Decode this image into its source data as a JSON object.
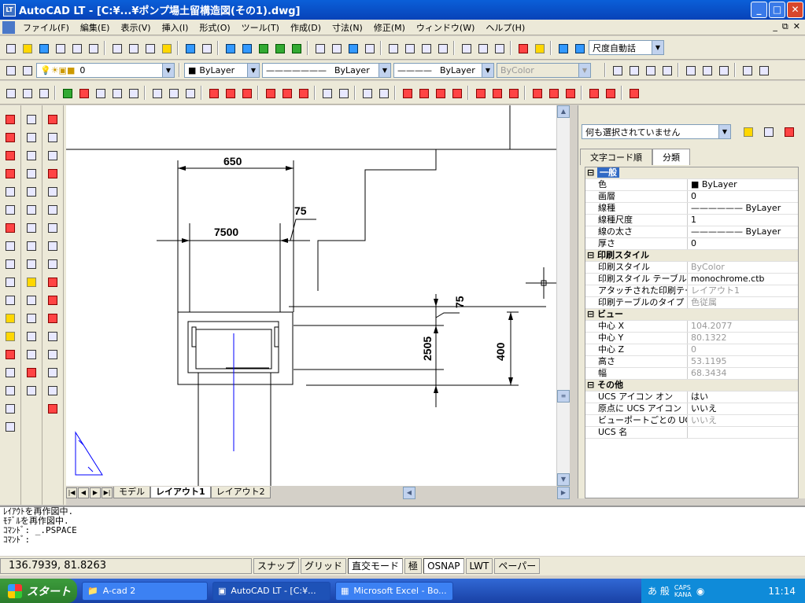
{
  "window": {
    "title": "AutoCAD LT - [C:¥...¥ポンプ場土留構造図(その1).dwg]",
    "min": "_",
    "max": "□",
    "close": "✕"
  },
  "menu": {
    "items": [
      "ファイル(F)",
      "編集(E)",
      "表示(V)",
      "挿入(I)",
      "形式(O)",
      "ツール(T)",
      "作成(D)",
      "寸法(N)",
      "修正(M)",
      "ウィンドウ(W)",
      "ヘルプ(H)"
    ],
    "mdi_min": "_",
    "mdi_restore": "⧉",
    "mdi_close": "✕"
  },
  "toolbar": {
    "dimstyle": "尺度自動話",
    "layer": "0",
    "color": "ByLayer",
    "linetype": "ByLayer",
    "lineweight": "ByLayer",
    "plotstyle": "ByColor"
  },
  "drawing": {
    "dim_650": "650",
    "dim_75_top": "75",
    "dim_7500": "7500",
    "dim_75_right": "75",
    "dim_2505": "2505",
    "dim_400": "400"
  },
  "tabs": {
    "model": "モデル",
    "layout1": "レイアウト1",
    "layout2": "レイアウト2"
  },
  "props": {
    "selection": "何も選択されていません",
    "tab_alpha": "文字コード順",
    "tab_cat": "分類",
    "general": "一般",
    "color_k": "色",
    "color_v": "■ ByLayer",
    "layer_k": "画層",
    "layer_v": "0",
    "ltype_k": "線種",
    "ltype_v": "——————  ByLayer",
    "ltscale_k": "線種尺度",
    "ltscale_v": "1",
    "lweight_k": "線の太さ",
    "lweight_v": "——————  ByLayer",
    "thick_k": "厚さ",
    "thick_v": "0",
    "plot": "印刷スタイル",
    "pstyle_k": "印刷スタイル",
    "pstyle_v": "ByColor",
    "ptable_k": "印刷スタイル テーブル",
    "ptable_v": "monochrome.ctb",
    "attach_k": "アタッチされた印刷テーブル",
    "attach_v": "レイアウト1",
    "ptype_k": "印刷テーブルのタイプ",
    "ptype_v": "色従属",
    "view": "ビュー",
    "cx_k": "中心 X",
    "cx_v": "104.2077",
    "cy_k": "中心 Y",
    "cy_v": "80.1322",
    "cz_k": "中心 Z",
    "cz_v": "0",
    "h_k": "高さ",
    "h_v": "53.1195",
    "w_k": "幅",
    "w_v": "68.3434",
    "misc": "その他",
    "ucson_k": "UCS アイコン オン",
    "ucson_v": "はい",
    "ucsorg_k": "原点に UCS アイコン",
    "ucsorg_v": "いいえ",
    "ucsvp_k": "ビューポートごとの UCS",
    "ucsvp_v": "いいえ",
    "ucsname_k": "UCS 名",
    "ucsname_v": ""
  },
  "command": {
    "line1": "ﾚｲｱｳﾄを再作図中.",
    "line2": "ﾓﾃﾞﾙを再作図中.",
    "line3": "ｺﾏﾝﾄﾞ: _.PSPACE",
    "line4": "ｺﾏﾝﾄﾞ:"
  },
  "status": {
    "coords": "136.7939, 81.8263",
    "snap": "スナップ",
    "grid": "グリッド",
    "ortho": "直交モード",
    "polar": "極",
    "osnap": "OSNAP",
    "lwt": "LWT",
    "paper": "ペーパー"
  },
  "taskbar": {
    "start": "スタート",
    "t1": "A-cad 2",
    "t2": "AutoCAD LT - [C:¥...",
    "t3": "Microsoft Excel - Bo...",
    "time": "11:14",
    "ime": "あ 般",
    "caps": "CAPS",
    "kana": "KANA"
  }
}
